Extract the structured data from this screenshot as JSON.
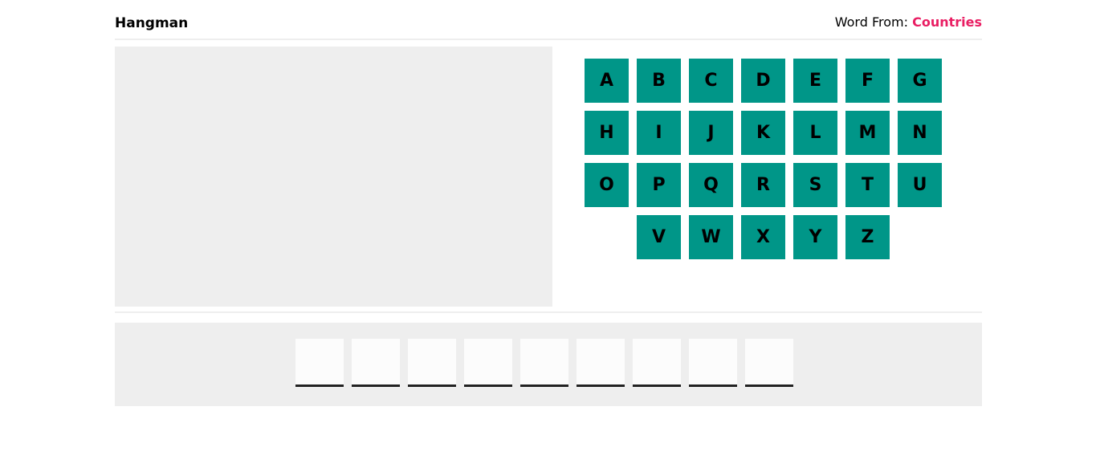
{
  "header": {
    "title": "Hangman",
    "word_from_label": "Word From: ",
    "category": "Countries"
  },
  "colors": {
    "letter_button": "#009688",
    "category": "#e91e63",
    "panel": "#eeeeee"
  },
  "letters": [
    "A",
    "B",
    "C",
    "D",
    "E",
    "F",
    "G",
    "H",
    "I",
    "J",
    "K",
    "L",
    "M",
    "N",
    "O",
    "P",
    "Q",
    "R",
    "S",
    "T",
    "U",
    "V",
    "W",
    "X",
    "Y",
    "Z"
  ],
  "word": {
    "length": 9,
    "revealed": [
      "",
      "",
      "",
      "",
      "",
      "",
      "",
      "",
      ""
    ]
  }
}
